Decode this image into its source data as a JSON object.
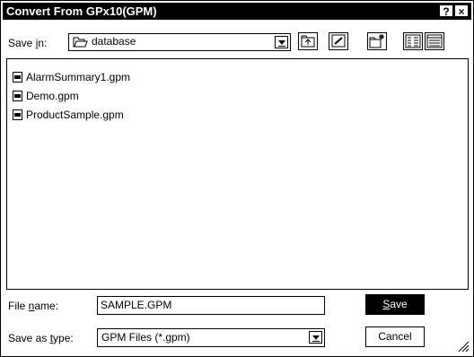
{
  "window": {
    "title": "Convert From GPx10(GPM)",
    "help_glyph": "?",
    "close_glyph": "×"
  },
  "toolbar": {
    "save_in_label_pre": "Save ",
    "save_in_label_key": "i",
    "save_in_label_post": "n:",
    "save_in_value": "database",
    "tools": [
      "up-one-level-icon",
      "desktop-icon",
      "new-folder-icon",
      "list-view-icon",
      "details-view-icon"
    ]
  },
  "files": [
    {
      "name": "AlarmSummary1.gpm"
    },
    {
      "name": "Demo.gpm"
    },
    {
      "name": "ProductSample.gpm"
    }
  ],
  "filename": {
    "label_pre": "File ",
    "label_key": "n",
    "label_post": "ame:",
    "value": "SAMPLE.GPM"
  },
  "filetype": {
    "label_pre": "Save as ",
    "label_key": "t",
    "label_post": "ype:",
    "value": "GPM Files (*.gpm)"
  },
  "buttons": {
    "save_key": "S",
    "save_rest": "ave",
    "cancel": "Cancel"
  }
}
